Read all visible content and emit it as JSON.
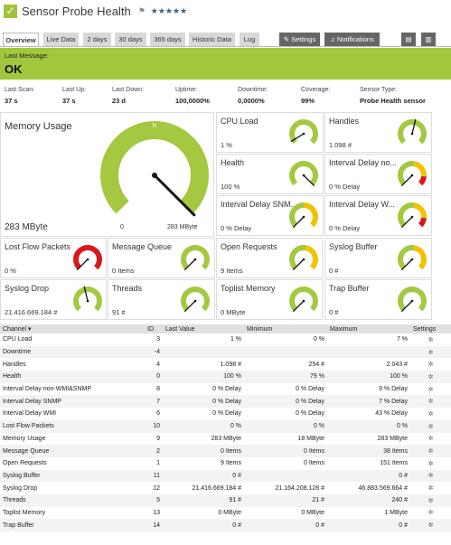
{
  "header": {
    "title": "Sensor Probe Health",
    "check_icon": "✓",
    "flag_icon": "⚑",
    "stars": "★★★★★"
  },
  "tabs": [
    {
      "label": "Overview",
      "active": true
    },
    {
      "label": "Live Data"
    },
    {
      "label": "2 days"
    },
    {
      "label": "30 days"
    },
    {
      "label": "365 days"
    },
    {
      "label": "Historic Data"
    },
    {
      "label": "Log"
    },
    {
      "label": "Settings",
      "icon": "wrench-icon"
    },
    {
      "label": "Notifications",
      "icon": "bell-icon"
    }
  ],
  "status": {
    "label": "Last Message:",
    "value": "OK"
  },
  "stats": [
    {
      "k": "Last Scan:",
      "v": "37 s"
    },
    {
      "k": "Last Up:",
      "v": "37 s"
    },
    {
      "k": "Last Down:",
      "v": "23 d"
    },
    {
      "k": "Uptime:",
      "v": "100,0000%"
    },
    {
      "k": "Downtime:",
      "v": "0,0000%"
    },
    {
      "k": "Coverage:",
      "v": "99%"
    },
    {
      "k": "Sensor Type:",
      "v": "Probe Health sensor"
    }
  ],
  "big_gauge": {
    "name": "Memory Usage",
    "value": "283 MByte",
    "min": "0",
    "max": "283 MByte",
    "level": 1.0,
    "top_mark": "R"
  },
  "gauges": [
    {
      "name": "CPU Load",
      "value": "1 %",
      "level": 0.05,
      "color": "green"
    },
    {
      "name": "Handles",
      "value": "1.098 #",
      "level": 0.55,
      "color": "green"
    },
    {
      "name": "Health",
      "value": "100 %",
      "level": 1.0,
      "color": "green"
    },
    {
      "name": "Interval Delay no...",
      "value": "0 % Delay",
      "level": 0.0,
      "color": "green-yellow-red"
    },
    {
      "name": "Interval Delay SNM...",
      "value": "0 % Delay",
      "level": 0.0,
      "color": "green-yellow"
    },
    {
      "name": "Interval Delay W...",
      "value": "0 % Delay",
      "level": 0.0,
      "color": "green-yellow-red"
    },
    {
      "name": "Lost Flow Packets",
      "value": "0 %",
      "level": 0.0,
      "color": "red"
    },
    {
      "name": "Message Queue",
      "value": "0 Items",
      "level": 0.0,
      "color": "green"
    },
    {
      "name": "Open Requests",
      "value": "9 Items",
      "level": 0.0,
      "color": "yellow"
    },
    {
      "name": "Syslog Buffer",
      "value": "0 #",
      "level": 0.0,
      "color": "yellow"
    },
    {
      "name": "Syslog Drop",
      "value": "21.416.669.184 #",
      "level": 0.45,
      "color": "green"
    },
    {
      "name": "Threads",
      "value": "91 #",
      "level": 0.0,
      "color": "green"
    },
    {
      "name": "Toplist Memory",
      "value": "0 MByte",
      "level": 0.0,
      "color": "green"
    },
    {
      "name": "Trap Buffer",
      "value": "0 #",
      "level": 0.0,
      "color": "green"
    }
  ],
  "table": {
    "headers": [
      "Channel ▾",
      "ID",
      "Last Value",
      "Minimum",
      "Maximum",
      "Settings"
    ],
    "settings_icon": "✲",
    "rows": [
      [
        "CPU Load",
        "3",
        "1 %",
        "0 %",
        "7 %"
      ],
      [
        "Downtime",
        "-4",
        "",
        "",
        ""
      ],
      [
        "Handles",
        "4",
        "1.098 #",
        "254 #",
        "2.043 #"
      ],
      [
        "Health",
        "0",
        "100 %",
        "79 %",
        "100 %"
      ],
      [
        "Interval Delay non-WMI&SNMP",
        "8",
        "0 % Delay",
        "0 % Delay",
        "9 % Delay"
      ],
      [
        "Interval Delay SNMP",
        "7",
        "0 % Delay",
        "0 % Delay",
        "7 % Delay"
      ],
      [
        "Interval Delay WMI",
        "6",
        "0 % Delay",
        "0 % Delay",
        "43 % Delay"
      ],
      [
        "Lost Flow Packets",
        "10",
        "0 %",
        "0 %",
        "0 %"
      ],
      [
        "Memory Usage",
        "9",
        "283 MByte",
        "18 MByte",
        "283 MByte"
      ],
      [
        "Message Queue",
        "2",
        "0 Items",
        "0 Items",
        "38 Items"
      ],
      [
        "Open Requests",
        "1",
        "9 Items",
        "0 Items",
        "151 Items"
      ],
      [
        "Syslog Buffer",
        "11",
        "0 #",
        "",
        "0 #"
      ],
      [
        "Syslog Drop",
        "12",
        "21.416.669.184 #",
        "21.164.208.128 #",
        "46.883.569.664 #"
      ],
      [
        "Threads",
        "5",
        "91 #",
        "21 #",
        "240 #"
      ],
      [
        "Toplist Memory",
        "13",
        "0 MByte",
        "0 MByte",
        "1 MByte"
      ],
      [
        "Trap Buffer",
        "14",
        "0 #",
        "0 #",
        "0 #"
      ]
    ]
  }
}
